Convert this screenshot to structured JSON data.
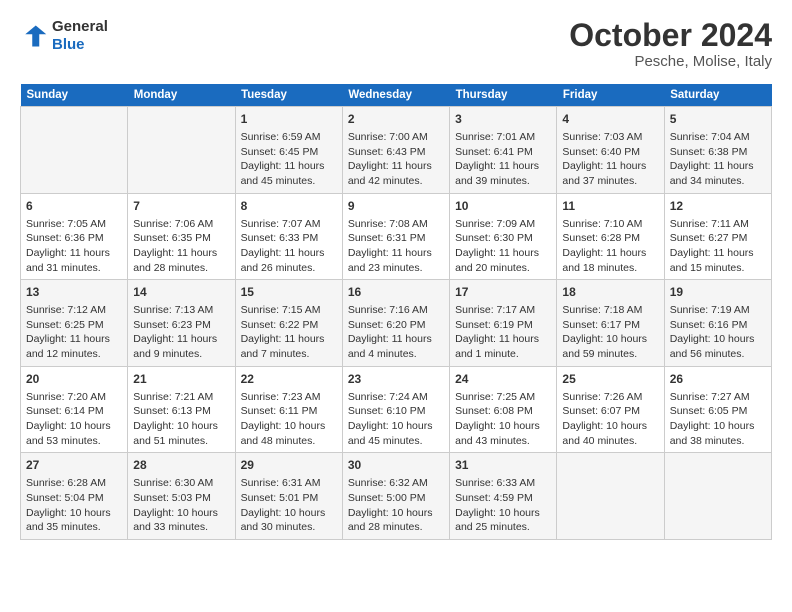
{
  "logo": {
    "line1": "General",
    "line2": "Blue"
  },
  "title": "October 2024",
  "subtitle": "Pesche, Molise, Italy",
  "days_of_week": [
    "Sunday",
    "Monday",
    "Tuesday",
    "Wednesday",
    "Thursday",
    "Friday",
    "Saturday"
  ],
  "weeks": [
    [
      {
        "day": "",
        "info": ""
      },
      {
        "day": "",
        "info": ""
      },
      {
        "day": "1",
        "info": "Sunrise: 6:59 AM\nSunset: 6:45 PM\nDaylight: 11 hours and 45 minutes."
      },
      {
        "day": "2",
        "info": "Sunrise: 7:00 AM\nSunset: 6:43 PM\nDaylight: 11 hours and 42 minutes."
      },
      {
        "day": "3",
        "info": "Sunrise: 7:01 AM\nSunset: 6:41 PM\nDaylight: 11 hours and 39 minutes."
      },
      {
        "day": "4",
        "info": "Sunrise: 7:03 AM\nSunset: 6:40 PM\nDaylight: 11 hours and 37 minutes."
      },
      {
        "day": "5",
        "info": "Sunrise: 7:04 AM\nSunset: 6:38 PM\nDaylight: 11 hours and 34 minutes."
      }
    ],
    [
      {
        "day": "6",
        "info": "Sunrise: 7:05 AM\nSunset: 6:36 PM\nDaylight: 11 hours and 31 minutes."
      },
      {
        "day": "7",
        "info": "Sunrise: 7:06 AM\nSunset: 6:35 PM\nDaylight: 11 hours and 28 minutes."
      },
      {
        "day": "8",
        "info": "Sunrise: 7:07 AM\nSunset: 6:33 PM\nDaylight: 11 hours and 26 minutes."
      },
      {
        "day": "9",
        "info": "Sunrise: 7:08 AM\nSunset: 6:31 PM\nDaylight: 11 hours and 23 minutes."
      },
      {
        "day": "10",
        "info": "Sunrise: 7:09 AM\nSunset: 6:30 PM\nDaylight: 11 hours and 20 minutes."
      },
      {
        "day": "11",
        "info": "Sunrise: 7:10 AM\nSunset: 6:28 PM\nDaylight: 11 hours and 18 minutes."
      },
      {
        "day": "12",
        "info": "Sunrise: 7:11 AM\nSunset: 6:27 PM\nDaylight: 11 hours and 15 minutes."
      }
    ],
    [
      {
        "day": "13",
        "info": "Sunrise: 7:12 AM\nSunset: 6:25 PM\nDaylight: 11 hours and 12 minutes."
      },
      {
        "day": "14",
        "info": "Sunrise: 7:13 AM\nSunset: 6:23 PM\nDaylight: 11 hours and 9 minutes."
      },
      {
        "day": "15",
        "info": "Sunrise: 7:15 AM\nSunset: 6:22 PM\nDaylight: 11 hours and 7 minutes."
      },
      {
        "day": "16",
        "info": "Sunrise: 7:16 AM\nSunset: 6:20 PM\nDaylight: 11 hours and 4 minutes."
      },
      {
        "day": "17",
        "info": "Sunrise: 7:17 AM\nSunset: 6:19 PM\nDaylight: 11 hours and 1 minute."
      },
      {
        "day": "18",
        "info": "Sunrise: 7:18 AM\nSunset: 6:17 PM\nDaylight: 10 hours and 59 minutes."
      },
      {
        "day": "19",
        "info": "Sunrise: 7:19 AM\nSunset: 6:16 PM\nDaylight: 10 hours and 56 minutes."
      }
    ],
    [
      {
        "day": "20",
        "info": "Sunrise: 7:20 AM\nSunset: 6:14 PM\nDaylight: 10 hours and 53 minutes."
      },
      {
        "day": "21",
        "info": "Sunrise: 7:21 AM\nSunset: 6:13 PM\nDaylight: 10 hours and 51 minutes."
      },
      {
        "day": "22",
        "info": "Sunrise: 7:23 AM\nSunset: 6:11 PM\nDaylight: 10 hours and 48 minutes."
      },
      {
        "day": "23",
        "info": "Sunrise: 7:24 AM\nSunset: 6:10 PM\nDaylight: 10 hours and 45 minutes."
      },
      {
        "day": "24",
        "info": "Sunrise: 7:25 AM\nSunset: 6:08 PM\nDaylight: 10 hours and 43 minutes."
      },
      {
        "day": "25",
        "info": "Sunrise: 7:26 AM\nSunset: 6:07 PM\nDaylight: 10 hours and 40 minutes."
      },
      {
        "day": "26",
        "info": "Sunrise: 7:27 AM\nSunset: 6:05 PM\nDaylight: 10 hours and 38 minutes."
      }
    ],
    [
      {
        "day": "27",
        "info": "Sunrise: 6:28 AM\nSunset: 5:04 PM\nDaylight: 10 hours and 35 minutes."
      },
      {
        "day": "28",
        "info": "Sunrise: 6:30 AM\nSunset: 5:03 PM\nDaylight: 10 hours and 33 minutes."
      },
      {
        "day": "29",
        "info": "Sunrise: 6:31 AM\nSunset: 5:01 PM\nDaylight: 10 hours and 30 minutes."
      },
      {
        "day": "30",
        "info": "Sunrise: 6:32 AM\nSunset: 5:00 PM\nDaylight: 10 hours and 28 minutes."
      },
      {
        "day": "31",
        "info": "Sunrise: 6:33 AM\nSunset: 4:59 PM\nDaylight: 10 hours and 25 minutes."
      },
      {
        "day": "",
        "info": ""
      },
      {
        "day": "",
        "info": ""
      }
    ]
  ]
}
